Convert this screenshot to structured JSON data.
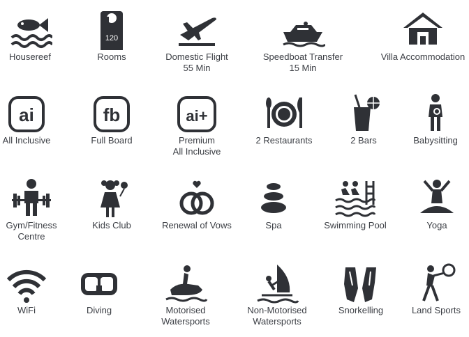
{
  "amenities": [
    {
      "label": "Housereef",
      "icon": "fish-icon"
    },
    {
      "label": "Rooms",
      "icon": "door-hanger-icon",
      "badge": "120"
    },
    {
      "label": "Domestic Flight\n55 Min",
      "icon": "plane-icon"
    },
    {
      "label": "Speedboat Transfer\n15 Min",
      "icon": "speedboat-icon"
    },
    {
      "label": "Villa Accommodation",
      "icon": "villa-icon"
    },
    {
      "label": "All Inclusive",
      "icon": "ai-icon",
      "badge": "ai"
    },
    {
      "label": "Full Board",
      "icon": "fb-icon",
      "badge": "fb"
    },
    {
      "label": "Premium\nAll Inclusive",
      "icon": "ai-plus-icon",
      "badge": "ai+"
    },
    {
      "label": "2 Restaurants",
      "icon": "restaurant-icon"
    },
    {
      "label": "2 Bars",
      "icon": "bar-icon"
    },
    {
      "label": "Babysitting",
      "icon": "babysitting-icon"
    },
    {
      "label": "Gym/Fitness\nCentre",
      "icon": "gym-icon"
    },
    {
      "label": "Kids Club",
      "icon": "kids-club-icon"
    },
    {
      "label": "Renewal of Vows",
      "icon": "rings-icon"
    },
    {
      "label": "Spa",
      "icon": "spa-stones-icon"
    },
    {
      "label": "Swimming Pool",
      "icon": "swimming-pool-icon"
    },
    {
      "label": "Yoga",
      "icon": "yoga-icon"
    },
    {
      "label": "WiFi",
      "icon": "wifi-icon"
    },
    {
      "label": "Diving",
      "icon": "diving-mask-icon"
    },
    {
      "label": "Motorised\nWatersports",
      "icon": "jetski-icon"
    },
    {
      "label": "Non-Motorised\nWatersports",
      "icon": "windsurf-icon"
    },
    {
      "label": "Snorkelling",
      "icon": "fins-icon"
    },
    {
      "label": "Land Sports",
      "icon": "tennis-icon"
    }
  ],
  "colors": {
    "icon": "#2f3136",
    "text": "#3b3e44"
  }
}
